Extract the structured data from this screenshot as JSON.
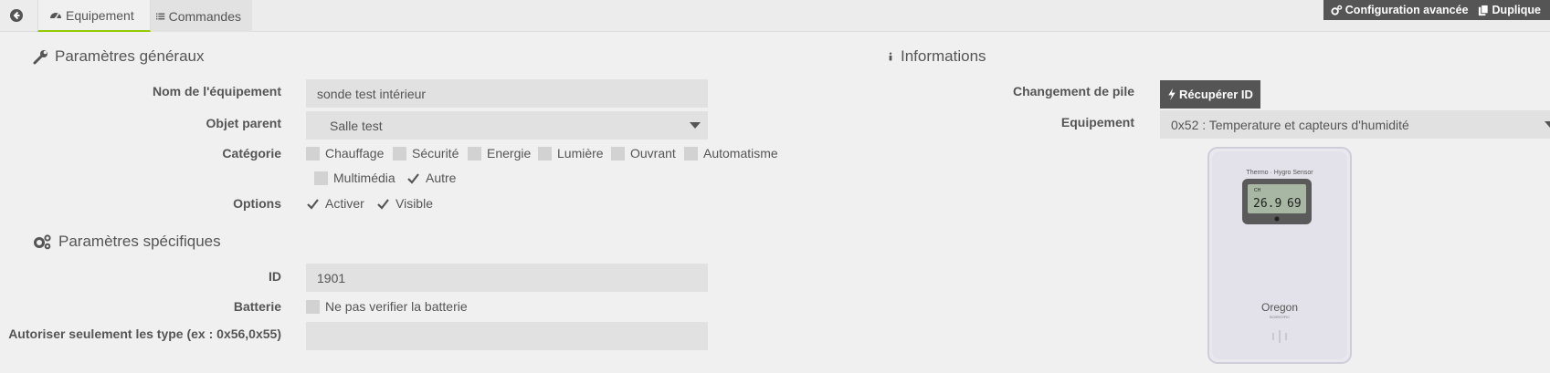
{
  "tabs": {
    "equipement": "Equipement",
    "commandes": "Commandes"
  },
  "top_buttons": {
    "config": "Configuration avancée",
    "duplicate": "Duplique"
  },
  "general": {
    "title": "Paramètres généraux",
    "name_label": "Nom de l'équipement",
    "name_value": "sonde test intérieur",
    "parent_label": "Objet parent",
    "parent_value": "Salle test",
    "category_label": "Catégorie",
    "categories": [
      {
        "label": "Chauffage",
        "checked": false
      },
      {
        "label": "Sécurité",
        "checked": false
      },
      {
        "label": "Energie",
        "checked": false
      },
      {
        "label": "Lumière",
        "checked": false
      },
      {
        "label": "Ouvrant",
        "checked": false
      },
      {
        "label": "Automatisme",
        "checked": false
      },
      {
        "label": "Multimédia",
        "checked": false
      },
      {
        "label": "Autre",
        "checked": true
      }
    ],
    "options_label": "Options",
    "options": [
      {
        "label": "Activer",
        "checked": true
      },
      {
        "label": "Visible",
        "checked": true
      }
    ]
  },
  "specific": {
    "title": "Paramètres spécifiques",
    "id_label": "ID",
    "id_value": "1901",
    "battery_label": "Batterie",
    "battery_option": "Ne pas verifier la batterie",
    "types_label": "Autoriser seulement les type (ex : 0x56,0x55)",
    "types_value": ""
  },
  "info": {
    "title": "Informations",
    "battery_change_label": "Changement de pile",
    "retrieve_id_button": "Récupérer ID",
    "equipment_label": "Equipement",
    "equipment_value": "0x52 : Temperature et capteurs d'humidité",
    "sensor_image": {
      "header": "Thermo · Hygro Sensor",
      "display_ch": "CH",
      "display_temp": "26.9",
      "display_hum": "69",
      "brand": "Oregon",
      "brand_sub": "SCIENTIFIC"
    }
  },
  "colors": {
    "accent_tab": "#94ca02",
    "dark_button": "#555555",
    "field_bg": "#e1e1e1"
  }
}
